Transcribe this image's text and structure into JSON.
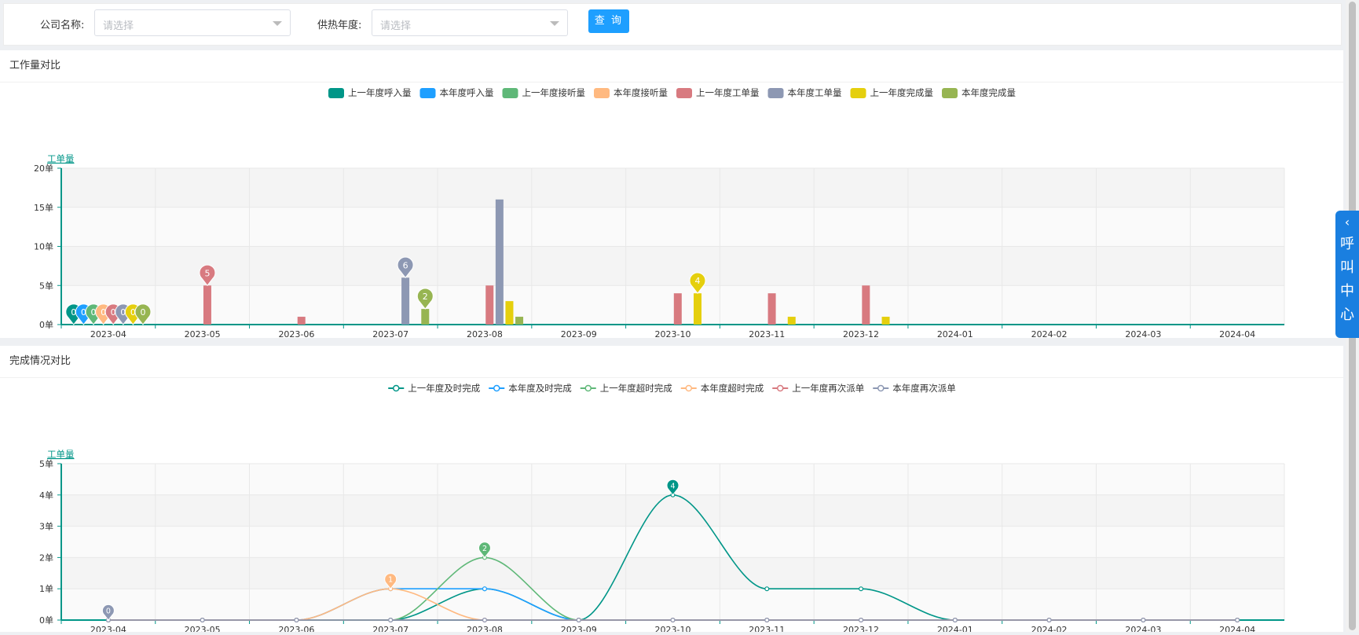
{
  "filters": {
    "company_label": "公司名称:",
    "company_placeholder": "请选择",
    "year_label": "供热年度:",
    "year_placeholder": "请选择",
    "query_button": "查 询"
  },
  "side_tab": {
    "chevron": "‹",
    "label": "呼\n叫\n中\n心"
  },
  "colors": {
    "teal": "#009688",
    "blue": "#1e9fff",
    "green": "#5fb878",
    "peach": "#ffb980",
    "red": "#d87a80",
    "gray": "#8d98b3",
    "yellow": "#e5cf0d",
    "olive": "#97b552"
  },
  "chart_data": [
    {
      "panel_title": "工作量对比",
      "type": "bar",
      "ylabel": "工单量",
      "y_ticks": [
        "0单",
        "5单",
        "10单",
        "15单",
        "20单"
      ],
      "ylim": [
        0,
        20
      ],
      "categories": [
        "2023-04",
        "2023-05",
        "2023-06",
        "2023-07",
        "2023-08",
        "2023-09",
        "2023-10",
        "2023-11",
        "2023-12",
        "2024-01",
        "2024-02",
        "2024-03",
        "2024-04"
      ],
      "legend_position": "top-center",
      "series": [
        {
          "name": "上一年度呼入量",
          "color": "#009688",
          "values": [
            0,
            0,
            0,
            0,
            0,
            0,
            0,
            0,
            0,
            0,
            0,
            0,
            0
          ]
        },
        {
          "name": "本年度呼入量",
          "color": "#1e9fff",
          "values": [
            0,
            0,
            0,
            0,
            0,
            0,
            0,
            0,
            0,
            0,
            0,
            0,
            0
          ]
        },
        {
          "name": "上一年度接听量",
          "color": "#5fb878",
          "values": [
            0,
            0,
            0,
            0,
            0,
            0,
            0,
            0,
            0,
            0,
            0,
            0,
            0
          ]
        },
        {
          "name": "本年度接听量",
          "color": "#ffb980",
          "values": [
            0,
            0,
            0,
            0,
            0,
            0,
            0,
            0,
            0,
            0,
            0,
            0,
            0
          ]
        },
        {
          "name": "上一年度工单量",
          "color": "#d87a80",
          "values": [
            0,
            5,
            1,
            0,
            5,
            0,
            4,
            4,
            5,
            0,
            0,
            0,
            0
          ]
        },
        {
          "name": "本年度工单量",
          "color": "#8d98b3",
          "values": [
            0,
            0,
            0,
            6,
            16,
            0,
            0,
            0,
            0,
            0,
            0,
            0,
            0
          ]
        },
        {
          "name": "上一年度完成量",
          "color": "#e5cf0d",
          "values": [
            0,
            0,
            0,
            0,
            3,
            0,
            4,
            1,
            1,
            0,
            0,
            0,
            0
          ]
        },
        {
          "name": "本年度完成量",
          "color": "#97b552",
          "values": [
            0,
            0,
            0,
            2,
            1,
            0,
            0,
            0,
            0,
            0,
            0,
            0,
            0
          ]
        }
      ],
      "markers": [
        {
          "series": 0,
          "index": 0,
          "label": "0"
        },
        {
          "series": 1,
          "index": 0,
          "label": "0"
        },
        {
          "series": 2,
          "index": 0,
          "label": "0"
        },
        {
          "series": 3,
          "index": 0,
          "label": "0"
        },
        {
          "series": 4,
          "index": 0,
          "label": "0"
        },
        {
          "series": 5,
          "index": 0,
          "label": "0"
        },
        {
          "series": 6,
          "index": 0,
          "label": "0"
        },
        {
          "series": 7,
          "index": 0,
          "label": "0"
        },
        {
          "series": 4,
          "index": 1,
          "label": "5"
        },
        {
          "series": 5,
          "index": 3,
          "label": "6"
        },
        {
          "series": 7,
          "index": 3,
          "label": "2"
        },
        {
          "series": 6,
          "index": 6,
          "label": "4"
        }
      ]
    },
    {
      "panel_title": "完成情况对比",
      "type": "line",
      "smooth": true,
      "ylabel": "工单量",
      "y_ticks": [
        "0单",
        "1单",
        "2单",
        "3单",
        "4单",
        "5单"
      ],
      "ylim": [
        0,
        5
      ],
      "categories": [
        "2023-04",
        "2023-05",
        "2023-06",
        "2023-07",
        "2023-08",
        "2023-09",
        "2023-10",
        "2023-11",
        "2023-12",
        "2024-01",
        "2024-02",
        "2024-03",
        "2024-04"
      ],
      "legend_position": "top-center",
      "series": [
        {
          "name": "上一年度及时完成",
          "color": "#009688",
          "values": [
            0,
            0,
            0,
            0,
            1,
            0,
            4,
            1,
            1,
            0,
            0,
            0,
            0
          ]
        },
        {
          "name": "本年度及时完成",
          "color": "#1e9fff",
          "values": [
            0,
            0,
            0,
            1,
            1,
            0,
            0,
            0,
            0,
            0,
            0,
            0,
            0
          ]
        },
        {
          "name": "上一年度超时完成",
          "color": "#5fb878",
          "values": [
            0,
            0,
            0,
            0,
            2,
            0,
            0,
            0,
            0,
            0,
            0,
            0,
            0
          ]
        },
        {
          "name": "本年度超时完成",
          "color": "#ffb980",
          "values": [
            0,
            0,
            0,
            1,
            0,
            0,
            0,
            0,
            0,
            0,
            0,
            0,
            0
          ]
        },
        {
          "name": "上一年度再次派单",
          "color": "#d87a80",
          "values": [
            0,
            0,
            0,
            0,
            0,
            0,
            0,
            0,
            0,
            0,
            0,
            0,
            0
          ]
        },
        {
          "name": "本年度再次派单",
          "color": "#8d98b3",
          "values": [
            0,
            0,
            0,
            0,
            0,
            0,
            0,
            0,
            0,
            0,
            0,
            0,
            0
          ]
        }
      ],
      "markers": [
        {
          "series": 0,
          "index": 6,
          "label": "4"
        },
        {
          "series": 2,
          "index": 4,
          "label": "2"
        },
        {
          "series": 3,
          "index": 3,
          "label": "1"
        },
        {
          "series": 5,
          "index": 0,
          "label": "0"
        }
      ]
    }
  ]
}
